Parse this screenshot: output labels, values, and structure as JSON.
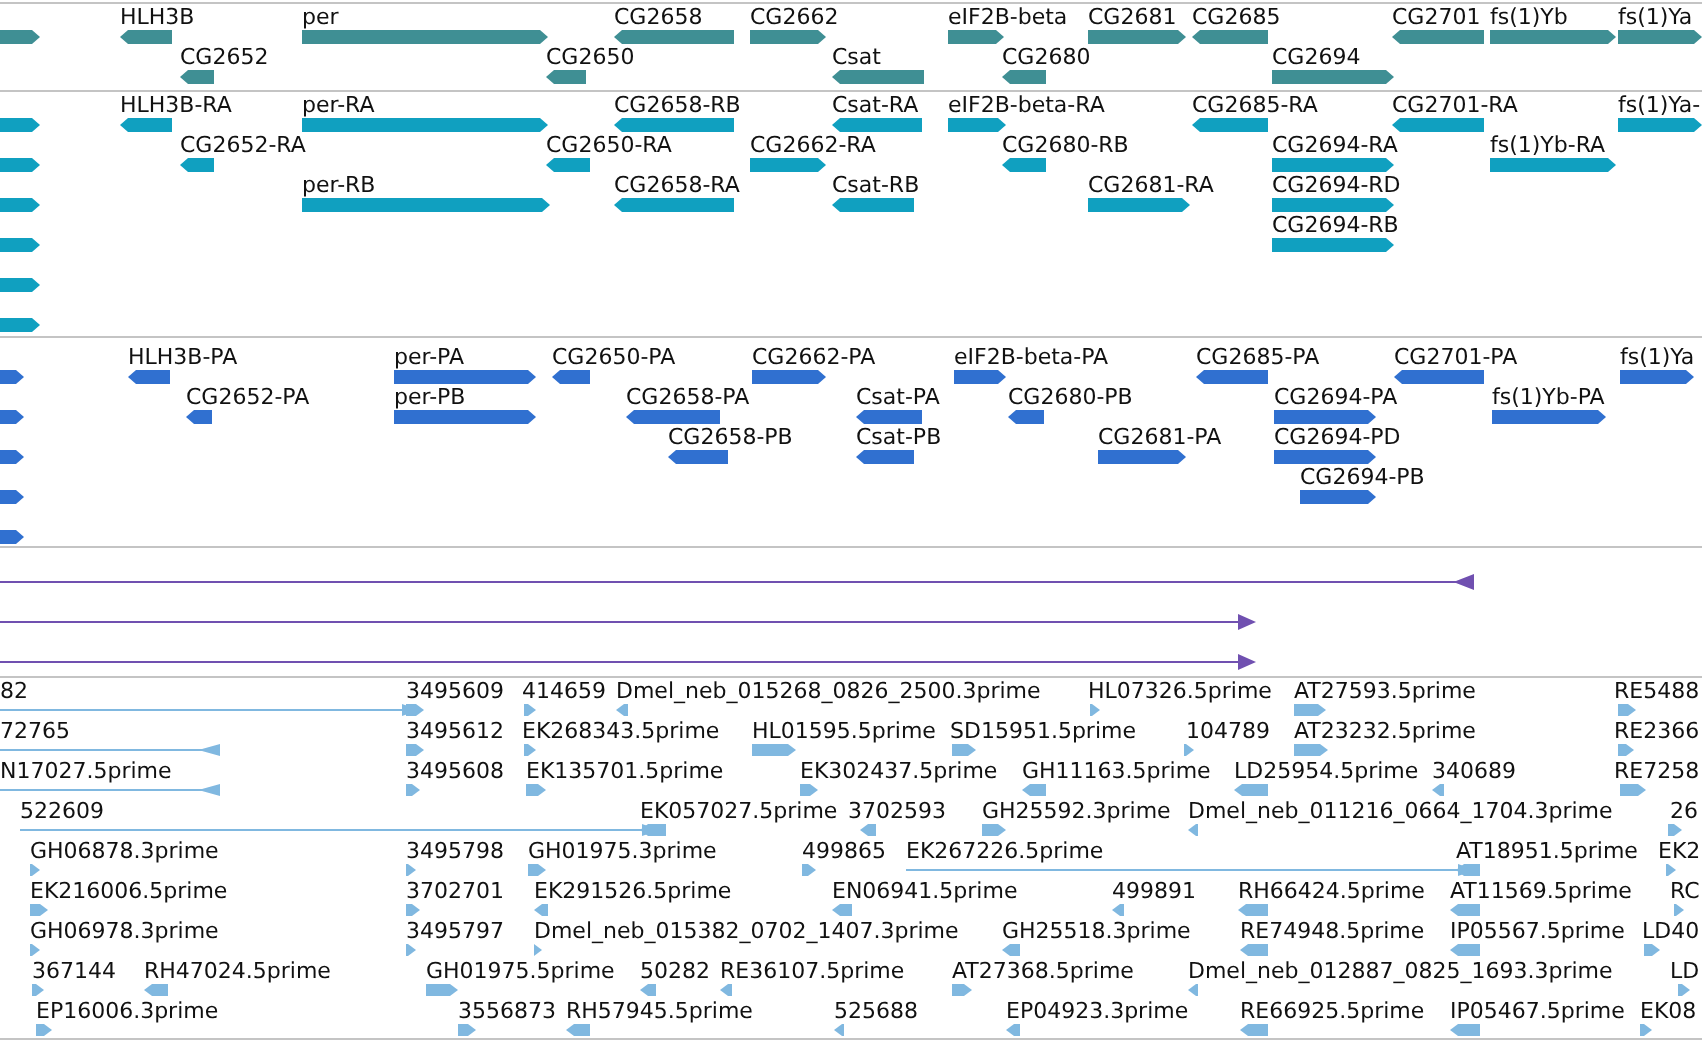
{
  "tracks": [
    {
      "kind": "gene",
      "color": "#3f8f94",
      "rows": [
        {
          "features": [
            {
              "reverse": false
            },
            {
              "label": "HLH3B",
              "reverse": true
            },
            {
              "label": "per",
              "reverse": false
            },
            {
              "label": "CG2658",
              "reverse": true
            },
            {
              "label": "CG2662",
              "reverse": false
            },
            {
              "label": "eIF2B-beta",
              "reverse": false
            },
            {
              "label": "CG2681",
              "reverse": false
            },
            {
              "label": "CG2685",
              "reverse": true
            },
            {
              "label": "CG2701",
              "reverse": true
            },
            {
              "label": "fs(1)Yb",
              "reverse": false
            },
            {
              "label": "fs(1)Ya",
              "reverse": false
            }
          ]
        },
        {
          "features": [
            {
              "label": "CG2652",
              "reverse": true
            },
            {
              "label": "CG2650",
              "reverse": true
            },
            {
              "label": "Csat",
              "reverse": true
            },
            {
              "label": "CG2680",
              "reverse": true
            },
            {
              "label": "CG2694",
              "reverse": false
            }
          ]
        }
      ]
    },
    {
      "kind": "mrna",
      "color": "#10a0c0",
      "rows": [
        {
          "features": [
            {
              "reverse": false
            },
            {
              "label": "HLH3B-RA",
              "reverse": true
            },
            {
              "label": "per-RA",
              "reverse": false
            },
            {
              "label": "CG2658-RB",
              "reverse": true
            },
            {
              "label": "Csat-RA",
              "reverse": true
            },
            {
              "label": "eIF2B-beta-RA",
              "reverse": false
            },
            {
              "label": "CG2685-RA",
              "reverse": true
            },
            {
              "label": "CG2701-RA",
              "reverse": true
            },
            {
              "label": "fs(1)Ya-",
              "reverse": false
            }
          ]
        },
        {
          "features": [
            {
              "reverse": false
            },
            {
              "label": "CG2652-RA",
              "reverse": true
            },
            {
              "label": "CG2650-RA",
              "reverse": true
            },
            {
              "label": "CG2662-RA",
              "reverse": false
            },
            {
              "label": "CG2680-RB",
              "reverse": true
            },
            {
              "label": "CG2694-RA",
              "reverse": false
            },
            {
              "label": "fs(1)Yb-RA",
              "reverse": false
            }
          ]
        },
        {
          "features": [
            {
              "reverse": false
            },
            {
              "label": "per-RB",
              "reverse": false
            },
            {
              "label": "CG2658-RA",
              "reverse": true
            },
            {
              "label": "Csat-RB",
              "reverse": true
            },
            {
              "label": "CG2681-RA",
              "reverse": false
            },
            {
              "label": "CG2694-RD",
              "reverse": false
            }
          ]
        },
        {
          "features": [
            {
              "reverse": false
            },
            {
              "label": "CG2694-RB",
              "reverse": false
            }
          ]
        },
        {
          "features": [
            {
              "reverse": false
            }
          ]
        },
        {
          "features": [
            {
              "reverse": false
            }
          ]
        }
      ]
    },
    {
      "kind": "cds",
      "color": "#3070d0",
      "rows": [
        {
          "features": [
            {
              "reverse": false
            },
            {
              "label": "HLH3B-PA",
              "reverse": true
            },
            {
              "label": "per-PA",
              "reverse": false
            },
            {
              "label": "CG2650-PA",
              "reverse": true
            },
            {
              "label": "CG2662-PA",
              "reverse": false
            },
            {
              "label": "eIF2B-beta-PA",
              "reverse": false
            },
            {
              "label": "CG2685-PA",
              "reverse": true
            },
            {
              "label": "CG2701-PA",
              "reverse": true
            },
            {
              "label": "fs(1)Ya",
              "reverse": false
            }
          ]
        },
        {
          "features": [
            {
              "reverse": false
            },
            {
              "label": "CG2652-PA",
              "reverse": true
            },
            {
              "label": "per-PB",
              "reverse": false
            },
            {
              "label": "CG2658-PA",
              "reverse": true
            },
            {
              "label": "Csat-PA",
              "reverse": true
            },
            {
              "label": "CG2680-PB",
              "reverse": true
            },
            {
              "label": "CG2694-PA",
              "reverse": false
            },
            {
              "label": "fs(1)Yb-PA",
              "reverse": false
            }
          ]
        },
        {
          "features": [
            {
              "reverse": false
            },
            {
              "label": "CG2658-PB",
              "reverse": true
            },
            {
              "label": "Csat-PB",
              "reverse": true
            },
            {
              "label": "CG2681-PA",
              "reverse": false
            },
            {
              "label": "CG2694-PD",
              "reverse": false
            }
          ]
        },
        {
          "features": [
            {
              "reverse": false
            },
            {
              "label": "CG2694-PB",
              "reverse": false
            }
          ]
        },
        {
          "features": [
            {
              "reverse": false
            }
          ]
        }
      ]
    },
    {
      "kind": "alignment",
      "color": "#7050b0",
      "rows": [
        {
          "features": [
            {
              "reverse": true
            }
          ]
        },
        {
          "features": [
            {
              "reverse": false
            }
          ]
        },
        {
          "features": [
            {
              "reverse": false
            }
          ]
        }
      ]
    },
    {
      "kind": "est",
      "color": "#80b8e0",
      "rows": [
        {
          "features": [
            {
              "label": "82",
              "reverse": false
            },
            {
              "label": "3495609",
              "reverse": false
            },
            {
              "label": "414659",
              "reverse": false
            },
            {
              "label": "Dmel_neb_015268_0826_2500.3prime",
              "reverse": true
            },
            {
              "label": "HL07326.5prime",
              "reverse": false
            },
            {
              "label": "AT27593.5prime",
              "reverse": false
            },
            {
              "label": "RE5488",
              "reverse": false
            }
          ]
        },
        {
          "features": [
            {
              "label": "72765",
              "reverse": true
            },
            {
              "label": "3495612",
              "reverse": false
            },
            {
              "label": "EK268343.5prime",
              "reverse": false
            },
            {
              "label": "HL01595.5prime",
              "reverse": false
            },
            {
              "label": "SD15951.5prime",
              "reverse": false
            },
            {
              "label": "104789",
              "reverse": false
            },
            {
              "label": "AT23232.5prime",
              "reverse": false
            },
            {
              "label": "RE2366",
              "reverse": false
            }
          ]
        },
        {
          "features": [
            {
              "label": "N17027.5prime",
              "reverse": true
            },
            {
              "label": "3495608",
              "reverse": false
            },
            {
              "label": "EK135701.5prime",
              "reverse": false
            },
            {
              "label": "EK302437.5prime",
              "reverse": false
            },
            {
              "label": "GH11163.5prime",
              "reverse": true
            },
            {
              "label": "LD25954.5prime",
              "reverse": true
            },
            {
              "label": "340689",
              "reverse": true
            },
            {
              "label": "RE7258",
              "reverse": false
            }
          ]
        },
        {
          "features": [
            {
              "label": "522609",
              "reverse": false
            },
            {
              "label": "EK057027.5prime",
              "reverse": true
            },
            {
              "label": "3702593",
              "reverse": true
            },
            {
              "label": "GH25592.3prime",
              "reverse": false
            },
            {
              "label": "Dmel_neb_011216_0664_1704.3prime",
              "reverse": true
            },
            {
              "label": "26",
              "reverse": false
            }
          ]
        },
        {
          "features": [
            {
              "label": "GH06878.3prime",
              "reverse": false
            },
            {
              "label": "3495798",
              "reverse": false
            },
            {
              "label": "GH01975.3prime",
              "reverse": false
            },
            {
              "label": "499865",
              "reverse": false
            },
            {
              "label": "EK267226.5prime",
              "reverse": false
            },
            {
              "label": "AT18951.5prime",
              "reverse": true
            },
            {
              "label": "EK2",
              "reverse": false
            }
          ]
        },
        {
          "features": [
            {
              "label": "EK216006.5prime",
              "reverse": false
            },
            {
              "label": "3702701",
              "reverse": false
            },
            {
              "label": "EK291526.5prime",
              "reverse": true
            },
            {
              "label": "EN06941.5prime",
              "reverse": true
            },
            {
              "label": "499891",
              "reverse": true
            },
            {
              "label": "RH66424.5prime",
              "reverse": true
            },
            {
              "label": "AT11569.5prime",
              "reverse": true
            },
            {
              "label": "RC",
              "reverse": false
            }
          ]
        },
        {
          "features": [
            {
              "label": "GH06978.3prime",
              "reverse": false
            },
            {
              "label": "3495797",
              "reverse": false
            },
            {
              "label": "Dmel_neb_015382_0702_1407.3prime",
              "reverse": false
            },
            {
              "label": "GH25518.3prime",
              "reverse": true
            },
            {
              "label": "RE74948.5prime",
              "reverse": true
            },
            {
              "label": "IP05567.5prime",
              "reverse": true
            },
            {
              "label": "LD40",
              "reverse": false
            }
          ]
        },
        {
          "features": [
            {
              "label": "367144",
              "reverse": false
            },
            {
              "label": "RH47024.5prime",
              "reverse": true
            },
            {
              "label": "GH01975.5prime",
              "reverse": false
            },
            {
              "label": "50282",
              "reverse": true
            },
            {
              "label": "RE36107.5prime",
              "reverse": true
            },
            {
              "label": "AT27368.5prime",
              "reverse": false
            },
            {
              "label": "Dmel_neb_012887_0825_1693.3prime",
              "reverse": true
            },
            {
              "label": "LD",
              "reverse": false
            }
          ]
        },
        {
          "features": [
            {
              "label": "EP16006.3prime",
              "reverse": false
            },
            {
              "label": "3556873",
              "reverse": false
            },
            {
              "label": "RH57945.5prime",
              "reverse": true
            },
            {
              "label": "525688",
              "reverse": true
            },
            {
              "label": "EP04923.3prime",
              "reverse": true
            },
            {
              "label": "RE66925.5prime",
              "reverse": true
            },
            {
              "label": "IP05467.5prime",
              "reverse": true
            },
            {
              "label": "EK08",
              "reverse": false
            }
          ]
        }
      ]
    }
  ]
}
